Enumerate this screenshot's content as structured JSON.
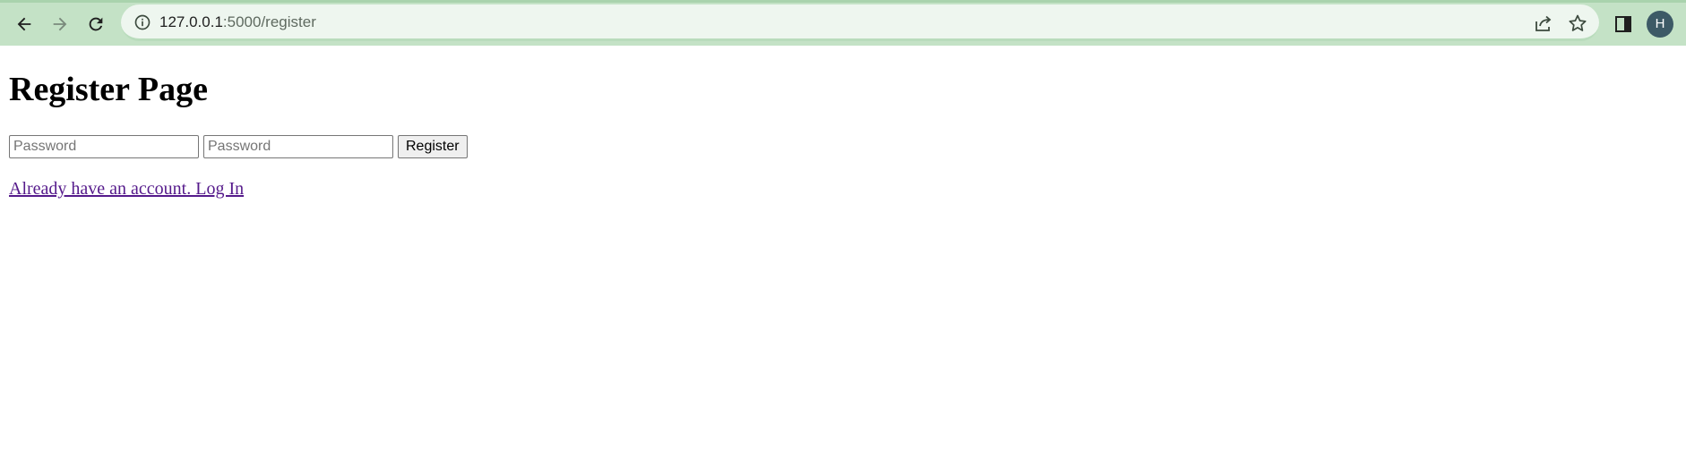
{
  "browser": {
    "url_host": "127.0.0.1",
    "url_path": ":5000/register",
    "profile_initial": "H",
    "icons": {
      "back": "back-arrow-icon",
      "forward": "forward-arrow-icon",
      "reload": "reload-icon",
      "site_info": "info-icon",
      "share": "share-icon",
      "bookmark": "star-icon",
      "side_panel": "side-panel-icon"
    },
    "colors": {
      "toolbar": "#c4e2c6",
      "omnibox": "#eef6ef",
      "avatar": "#3d5a66"
    }
  },
  "page": {
    "title": "Register Page",
    "form": {
      "password_placeholder_1": "Password",
      "password_placeholder_2": "Password",
      "submit_label": "Register"
    },
    "login_link": "Already have an account. Log In",
    "link_color": "#551a8b"
  }
}
